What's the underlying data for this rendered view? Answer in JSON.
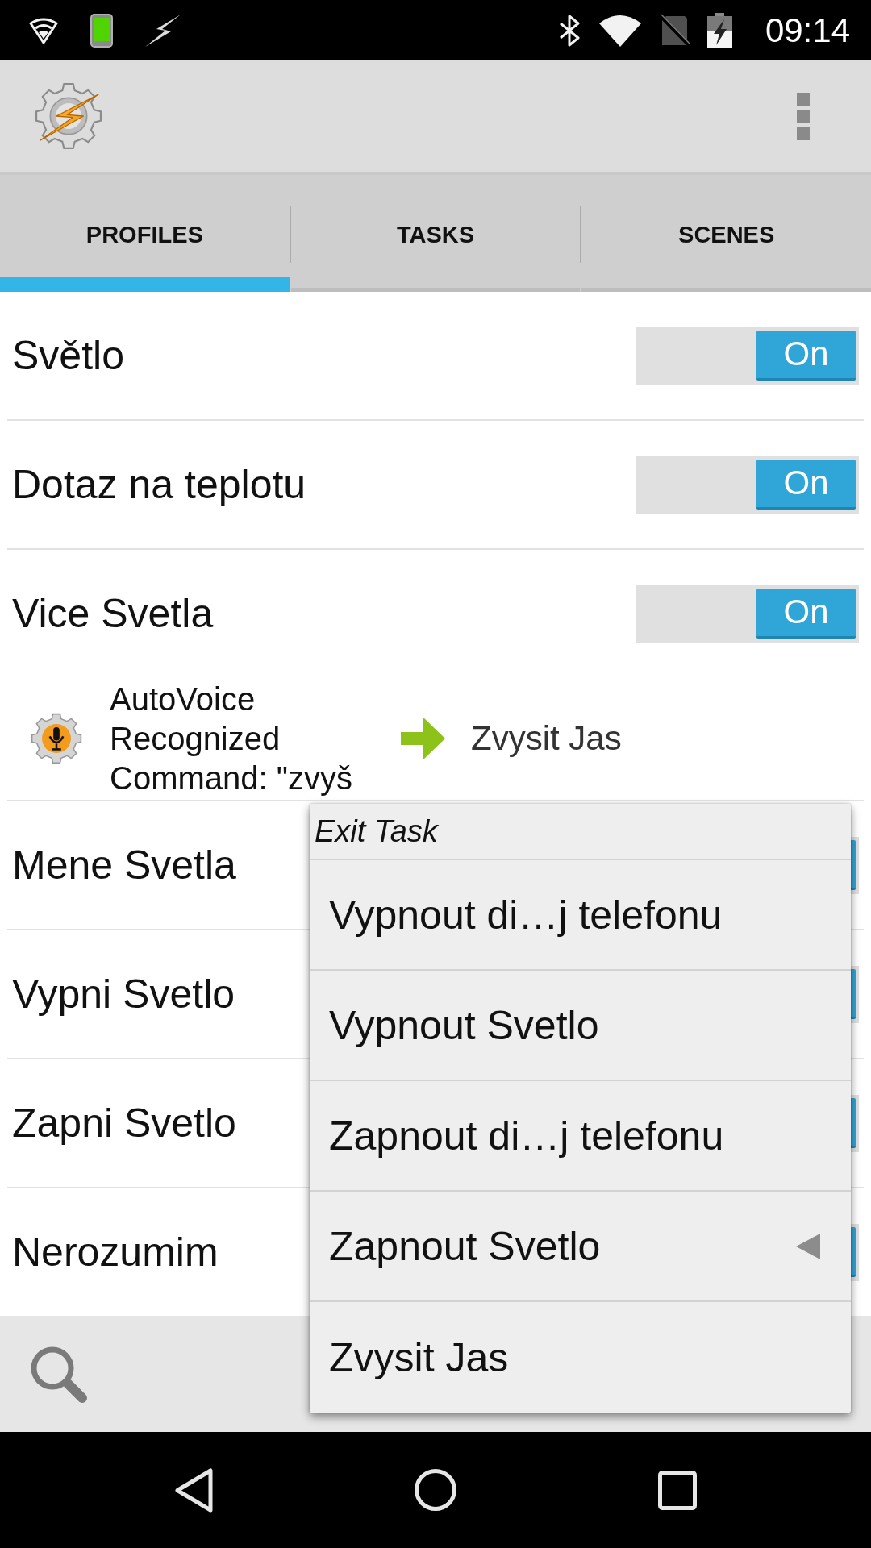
{
  "status_bar": {
    "time": "09:14"
  },
  "tabs": [
    {
      "label": "PROFILES",
      "selected": true
    },
    {
      "label": "TASKS",
      "selected": false
    },
    {
      "label": "SCENES",
      "selected": false
    }
  ],
  "profiles": [
    {
      "name": "Světlo",
      "toggle": {
        "on": true,
        "label": "On"
      }
    },
    {
      "name": "Dotaz na teplotu",
      "toggle": {
        "on": true,
        "label": "On"
      }
    },
    {
      "name": "Vice Svetla",
      "toggle": {
        "on": true,
        "label": "On"
      },
      "context": "AutoVoice Recognized Command: \"zvyš",
      "task": "Zvysit Jas"
    },
    {
      "name": "Mene Svetla",
      "toggle": {
        "on": true
      }
    },
    {
      "name": "Vypni Svetlo",
      "toggle": {
        "on": true
      }
    },
    {
      "name": "Zapni Svetlo",
      "toggle": {
        "on": true
      }
    },
    {
      "name": "Nerozumim",
      "toggle": {
        "on": true
      }
    }
  ],
  "popup_menu": {
    "title": "Exit Task",
    "items": [
      {
        "label": "Vypnout di…j telefonu",
        "selected": false
      },
      {
        "label": "Vypnout Svetlo",
        "selected": false
      },
      {
        "label": "Zapnout di…j telefonu",
        "selected": false
      },
      {
        "label": "Zapnout Svetlo",
        "selected": true
      },
      {
        "label": "Zvysit Jas",
        "selected": false
      }
    ]
  }
}
